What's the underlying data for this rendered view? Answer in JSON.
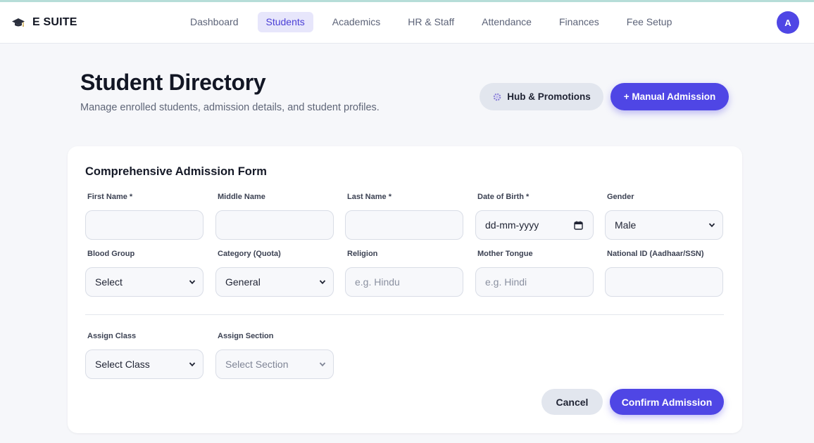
{
  "app": {
    "name": "E SUITE",
    "avatar_initial": "A",
    "accent": "#4f46e5"
  },
  "nav": {
    "items": [
      {
        "label": "Dashboard",
        "active": false
      },
      {
        "label": "Students",
        "active": true
      },
      {
        "label": "Academics",
        "active": false
      },
      {
        "label": "HR & Staff",
        "active": false
      },
      {
        "label": "Attendance",
        "active": false
      },
      {
        "label": "Finances",
        "active": false
      },
      {
        "label": "Fee Setup",
        "active": false
      }
    ]
  },
  "header": {
    "title": "Student Directory",
    "subtitle": "Manage enrolled students, admission details, and student profiles.",
    "hub_button": "Hub & Promotions",
    "manual_button": "+ Manual Admission"
  },
  "form": {
    "title": "Comprehensive Admission Form",
    "fields": {
      "first_name": {
        "label": "First Name *",
        "value": ""
      },
      "middle_name": {
        "label": "Middle Name",
        "value": ""
      },
      "last_name": {
        "label": "Last Name *",
        "value": ""
      },
      "dob": {
        "label": "Date of Birth *",
        "value": "dd-mm-yyyy"
      },
      "gender": {
        "label": "Gender",
        "value": "Male"
      },
      "blood_group": {
        "label": "Blood Group",
        "value": "Select"
      },
      "category": {
        "label": "Category (Quota)",
        "value": "General"
      },
      "religion": {
        "label": "Religion",
        "placeholder": "e.g. Hindu"
      },
      "mother_tongue": {
        "label": "Mother Tongue",
        "placeholder": "e.g. Hindi"
      },
      "national_id": {
        "label": "National ID (Aadhaar/SSN)",
        "value": ""
      },
      "assign_class": {
        "label": "Assign Class",
        "value": "Select Class"
      },
      "assign_section": {
        "label": "Assign Section",
        "value": "Select Section"
      }
    },
    "cancel_button": "Cancel",
    "confirm_button": "Confirm Admission"
  }
}
